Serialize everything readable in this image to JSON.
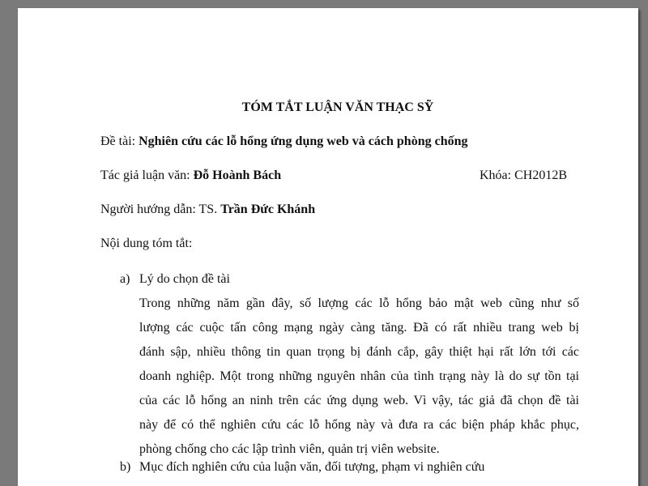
{
  "document": {
    "title": "TÓM TẮT LUẬN VĂN THẠC SỸ",
    "topic": {
      "label": "Đề tài: ",
      "value": "Nghiên cứu các lỗ hổng ứng dụng web và cách phòng chống"
    },
    "author": {
      "label": "Tác giả luận văn: ",
      "value": "Đỗ Hoành Bách"
    },
    "course": {
      "label": "Khóa: ",
      "value": "CH2012B"
    },
    "supervisor": {
      "label": "Người hướng dẫn: TS. ",
      "value": "Trần Đức Khánh"
    },
    "summary_heading": "Nội dung tóm tắt:",
    "sections": [
      {
        "marker": "a)",
        "heading": "Lý do chọn đề tài",
        "lines": [
          "Trong những năm gần đây, số lượng các lỗ hổng bảo mật web cũng như số",
          "lượng các cuộc tấn công mạng ngày càng tăng. Đã có rất nhiều trang web bị",
          "đánh sập, nhiều thông tin quan trọng bị đánh cắp, gây thiệt hại rất lớn tới các",
          "doanh nghiệp. Một trong những nguyên nhân của tình trạng này là do sự tồn tại",
          "của các lỗ hổng an ninh trên các ứng dụng web. Vì vậy, tác giả đã chọn đề tài",
          "này để có thể nghiên cứu các lỗ hổng này và đưa ra các biện pháp khắc phục,",
          "phòng chống cho các lập trình viên, quản trị viên website."
        ]
      },
      {
        "marker": "b)",
        "heading": "Mục đích nghiên cứu của luận văn, đối tượng, phạm vi nghiên cứu"
      }
    ]
  }
}
